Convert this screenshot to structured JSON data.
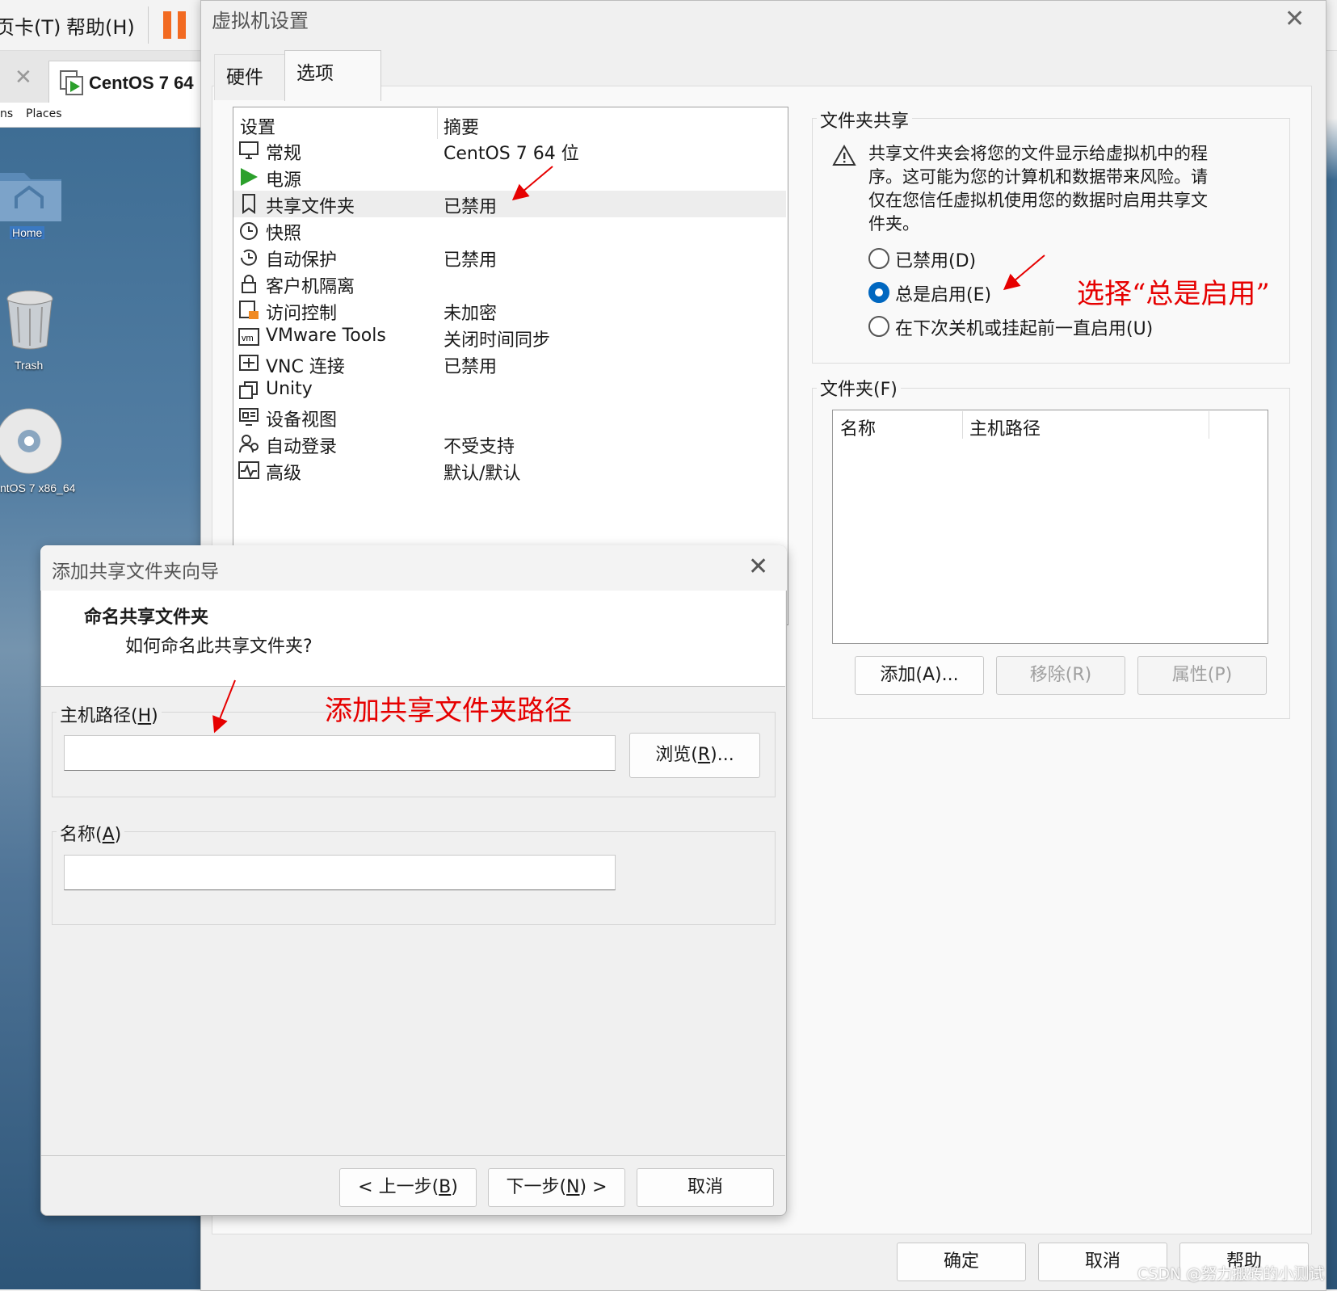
{
  "vmware": {
    "menu_tab": "页卡(T)",
    "menu_help": "帮助(H)",
    "vm_tab_label": "CentOS 7 64",
    "gnome_bar_left": "ns",
    "gnome_bar_places": "Places",
    "desktop_home": "Home",
    "desktop_trash": "Trash",
    "desktop_disc": "ntOS 7 x86_64"
  },
  "settings": {
    "title": "虚拟机设置",
    "tabs": [
      "硬件",
      "选项"
    ],
    "active_tab": "选项",
    "list_header": {
      "setting": "设置",
      "summary": "摘要"
    },
    "rows": [
      {
        "name": "常规",
        "summary": "CentOS 7 64 位",
        "icon": "monitor-icon"
      },
      {
        "name": "电源",
        "summary": "",
        "icon": "play-icon"
      },
      {
        "name": "共享文件夹",
        "summary": "已禁用",
        "icon": "shared-folder-icon"
      },
      {
        "name": "快照",
        "summary": "",
        "icon": "snapshot-icon"
      },
      {
        "name": "自动保护",
        "summary": "已禁用",
        "icon": "autoprotect-icon"
      },
      {
        "name": "客户机隔离",
        "summary": "",
        "icon": "lock-icon"
      },
      {
        "name": "访问控制",
        "summary": "未加密",
        "icon": "access-control-icon"
      },
      {
        "name": "VMware Tools",
        "summary": "关闭时间同步",
        "icon": "vm-icon"
      },
      {
        "name": "VNC 连接",
        "summary": "已禁用",
        "icon": "vnc-icon"
      },
      {
        "name": "Unity",
        "summary": "",
        "icon": "unity-icon"
      },
      {
        "name": "设备视图",
        "summary": "",
        "icon": "device-view-icon"
      },
      {
        "name": "自动登录",
        "summary": "不受支持",
        "icon": "autologin-icon"
      },
      {
        "name": "高级",
        "summary": "默认/默认",
        "icon": "advanced-icon"
      }
    ],
    "selected_row": "共享文件夹",
    "sharing": {
      "group_title": "文件夹共享",
      "warning": "共享文件夹会将您的文件显示给虚拟机中的程序。这可能为您的计算机和数据带来风险。请仅在您信任虚拟机使用您的数据时启用共享文件夹。",
      "options": [
        "已禁用(D)",
        "总是启用(E)",
        "在下次关机或挂起前一直启用(U)"
      ],
      "selected_option": "总是启用(E)"
    },
    "folders": {
      "group_title": "文件夹(F)",
      "col_name": "名称",
      "col_path": "主机路径",
      "add": "添加(A)...",
      "remove": "移除(R)",
      "properties": "属性(P)"
    },
    "ok": "确定",
    "cancel": "取消",
    "help": "帮助"
  },
  "wizard": {
    "title": "添加共享文件夹向导",
    "heading": "命名共享文件夹",
    "subheading": "如何命名此共享文件夹?",
    "host_path_label_pre": "主机路径(",
    "host_path_label_key": "H",
    "host_path_label_post": ")",
    "host_path_value": "",
    "browse_pre": "浏览(",
    "browse_key": "R",
    "browse_post": ")...",
    "name_label_pre": "名称(",
    "name_label_key": "A",
    "name_label_post": ")",
    "name_value": "",
    "back_pre": "< 上一步(",
    "back_key": "B",
    "back_post": ")",
    "next_pre": "下一步(",
    "next_key": "N",
    "next_post": ") >",
    "cancel": "取消"
  },
  "annotations": {
    "select_always": "选择“总是启用”",
    "add_path": "添加共享文件夹路径",
    "color": "#e60000"
  },
  "watermark": "CSDN @努力搬砖的小测试"
}
